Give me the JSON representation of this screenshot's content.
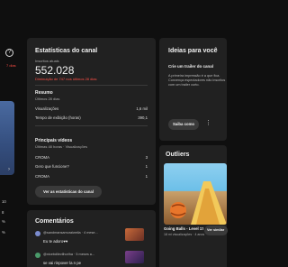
{
  "left": {
    "help_icon": "?",
    "badge": "7 dias",
    "chevron": "›",
    "stats": [
      "10",
      "8",
      "%",
      "%"
    ]
  },
  "stats_card": {
    "title": "Estatísticas do canal",
    "subs_label": "Inscritos atuais",
    "subs_value": "552.028",
    "subs_delta": "Diminuição de 747 nos últimos 28 dias",
    "summary_title": "Resumo",
    "summary_period": "Últimos 28 dias",
    "rows": [
      {
        "label": "Visualizações",
        "value": "1,6 mil"
      },
      {
        "label": "Tempo de exibição (horas)",
        "value": "390,1"
      }
    ],
    "top_title": "Principais vídeos",
    "top_period": "Últimas 48 horas · Visualizações",
    "videos": [
      {
        "title": "CROMA",
        "value": "3"
      },
      {
        "title": "Gero que funcione?",
        "value": "1"
      },
      {
        "title": "CROMA",
        "value": "1"
      }
    ],
    "button": "Ver as estatísticas do canal"
  },
  "comments": {
    "title": "Comentários",
    "items": [
      {
        "author": "@sandmansamuraiweila",
        "ago": "· 4 mese...",
        "text": "Eu te adoro♥♥"
      },
      {
        "author": "@nicebdilevilhorlha",
        "ago": "· 5 meses a...",
        "text": "se vai rinpover la n pe"
      }
    ]
  },
  "ideas": {
    "title": "Ideias para você",
    "card_title": "Crie um trailer do canal",
    "card_text": "A primeira impressão é a que fica. Convença espectadores não inscritos com um trailer curto.",
    "button": "Saiba como"
  },
  "outliers": {
    "title": "Outliers",
    "video_title": "Going Balls - Level 1753 to 17",
    "video_meta": "18 mi visualizações · 4 anos atrás",
    "similar_label": "Ver similar"
  },
  "colors": {
    "bg": "#0f0f0f",
    "card": "#212121",
    "alert": "#ff4e45"
  }
}
